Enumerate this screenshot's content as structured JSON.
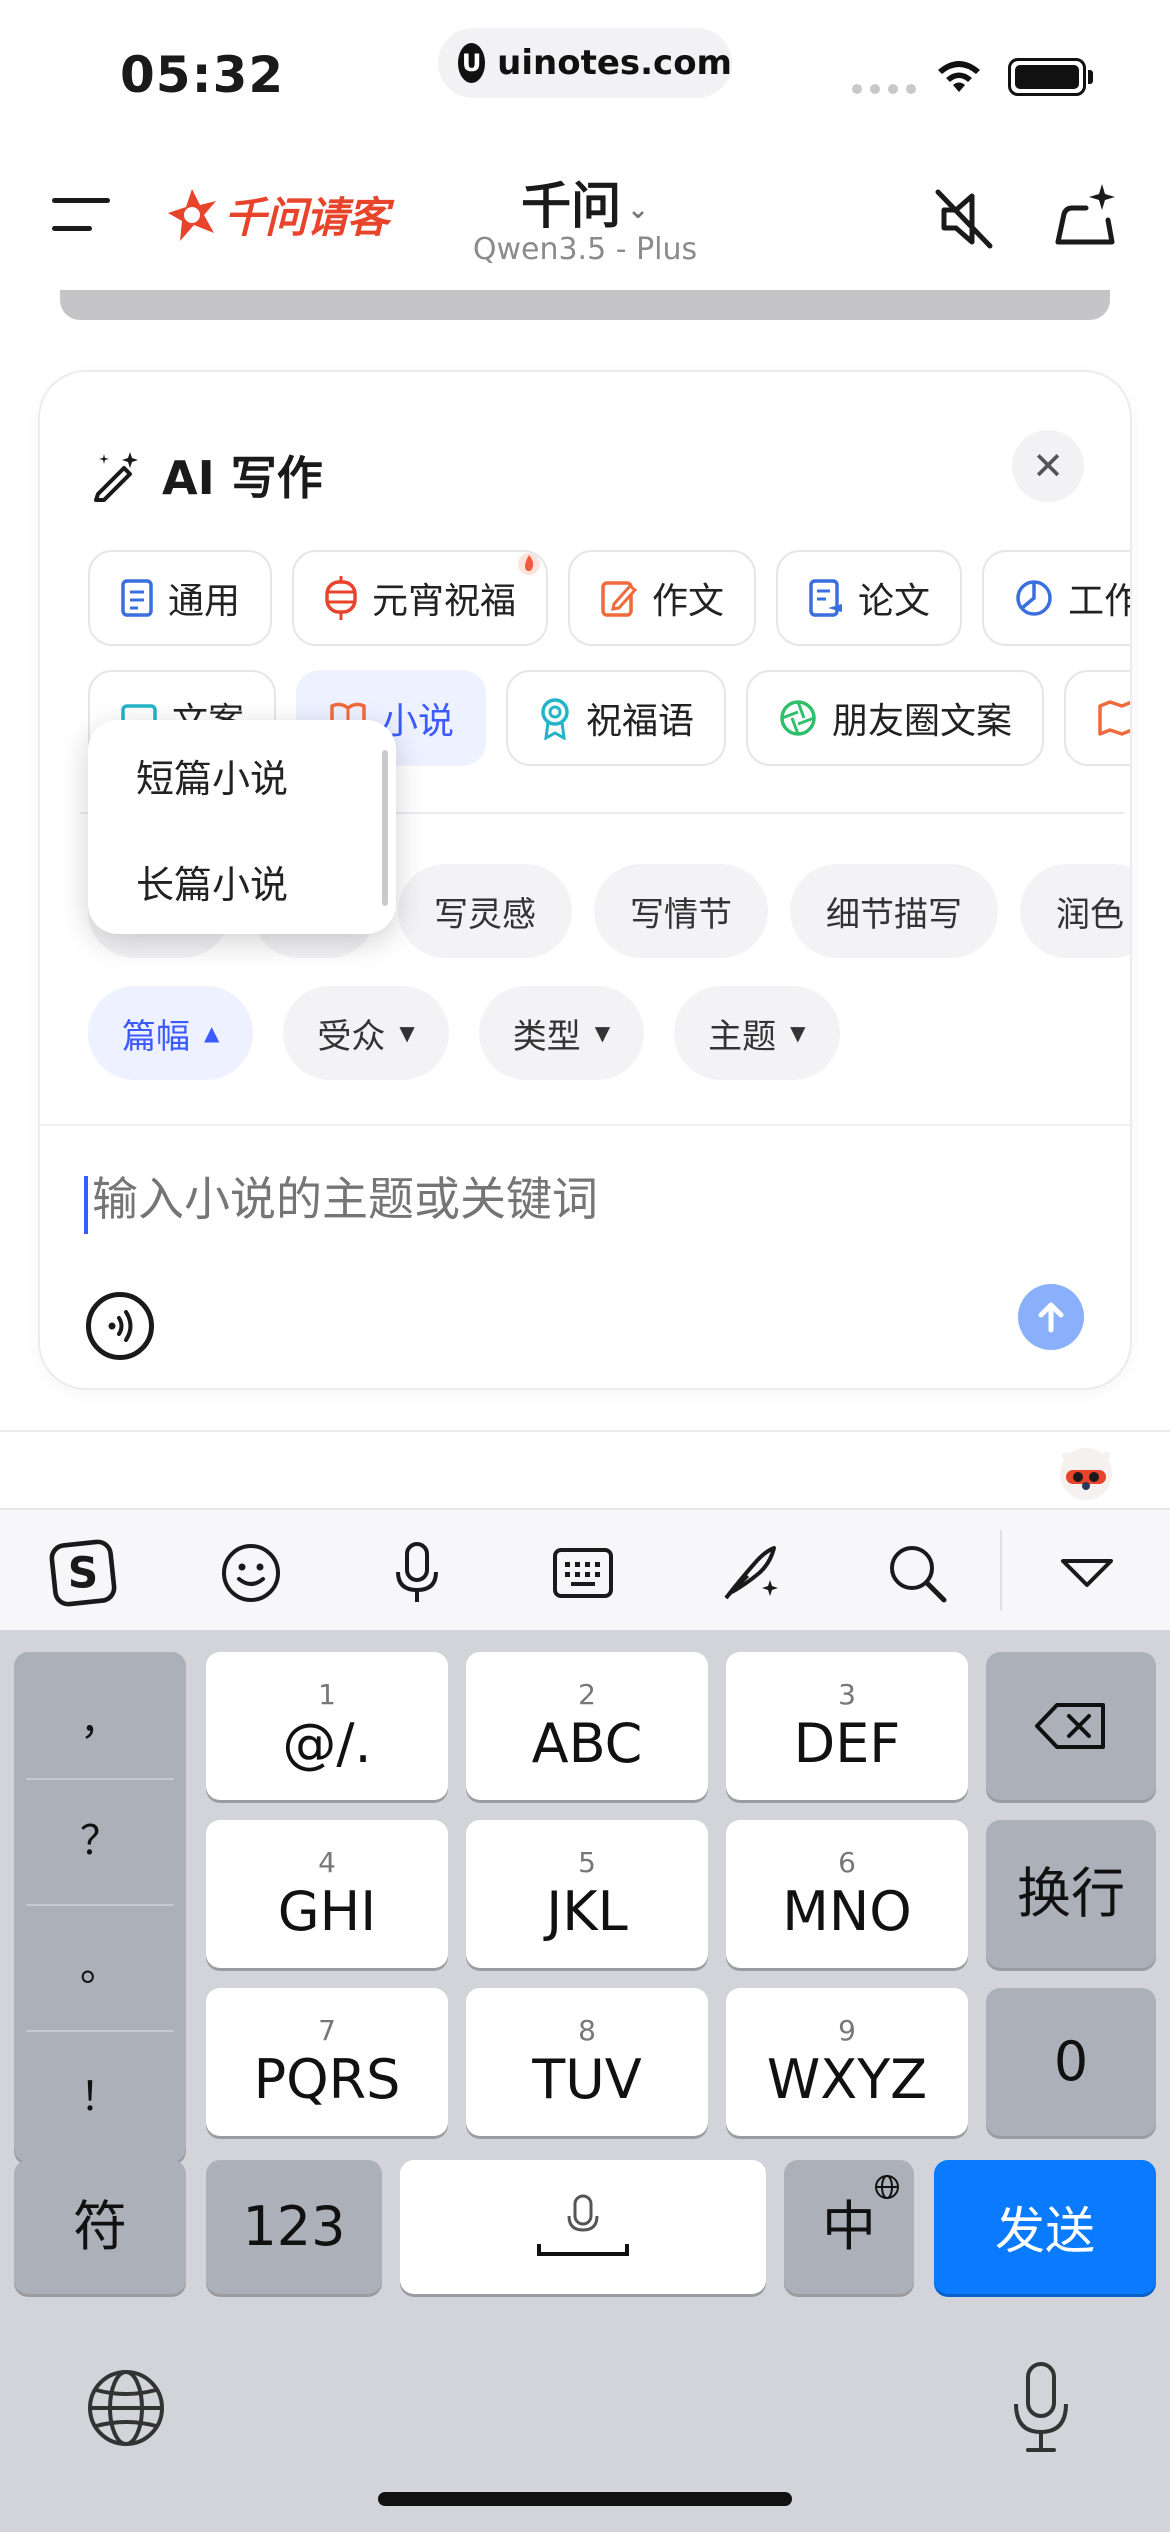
{
  "status_bar": {
    "time": "05:32",
    "url": "uinotes.com",
    "url_logo": "U"
  },
  "header": {
    "brand": "千问请客",
    "model_name": "千问",
    "model_version": "Qwen3.5 - Plus"
  },
  "card": {
    "title": "AI 写作",
    "close_label": "✕",
    "categories_row1": [
      {
        "label": "通用",
        "icon": "document-icon"
      },
      {
        "label": "元宵祝福",
        "icon": "lantern-icon"
      },
      {
        "label": "作文",
        "icon": "edit-icon"
      },
      {
        "label": "论文",
        "icon": "paper-icon"
      },
      {
        "label": "工作",
        "icon": "chart-icon"
      }
    ],
    "categories_row2": [
      {
        "label": "文案",
        "icon": "frame-icon"
      },
      {
        "label": "小说",
        "icon": "book-icon"
      },
      {
        "label": "祝福语",
        "icon": "badge-icon"
      },
      {
        "label": "朋友圈文案",
        "icon": "aperture-icon"
      },
      {
        "label": "",
        "icon": "map-icon"
      }
    ],
    "subtasks": [
      "写灵感",
      "写情节",
      "细节描写",
      "润色"
    ],
    "filters": [
      {
        "label": "篇幅",
        "caret": "▲"
      },
      {
        "label": "受众",
        "caret": "▼"
      },
      {
        "label": "类型",
        "caret": "▼"
      },
      {
        "label": "主题",
        "caret": "▼"
      }
    ],
    "input_placeholder": "输入小说的主题或关键词"
  },
  "dropdown": {
    "items": [
      "短篇小说",
      "长篇小说"
    ]
  },
  "keyboard": {
    "toolbar": [
      "sogou-logo-icon",
      "emoji-icon",
      "microphone-icon",
      "keyboard-icon",
      "handwriting-icon",
      "search-icon",
      "collapse-icon"
    ],
    "punctuation": [
      "，",
      "？",
      "。",
      "！"
    ],
    "keys": [
      {
        "num": "1",
        "label": "@/."
      },
      {
        "num": "2",
        "label": "ABC"
      },
      {
        "num": "3",
        "label": "DEF"
      },
      {
        "num": "4",
        "label": "GHI"
      },
      {
        "num": "5",
        "label": "JKL"
      },
      {
        "num": "6",
        "label": "MNO"
      },
      {
        "num": "7",
        "label": "PQRS"
      },
      {
        "num": "8",
        "label": "TUV"
      },
      {
        "num": "9",
        "label": "WXYZ"
      }
    ],
    "return_label": "换行",
    "zero_label": "0",
    "symbol_label": "符",
    "numeric_label": "123",
    "lang_label": "中",
    "send_label": "发送"
  },
  "colors": {
    "accent": "#3b5bff",
    "brand": "#e8442c",
    "send_key": "#0a7bff"
  }
}
